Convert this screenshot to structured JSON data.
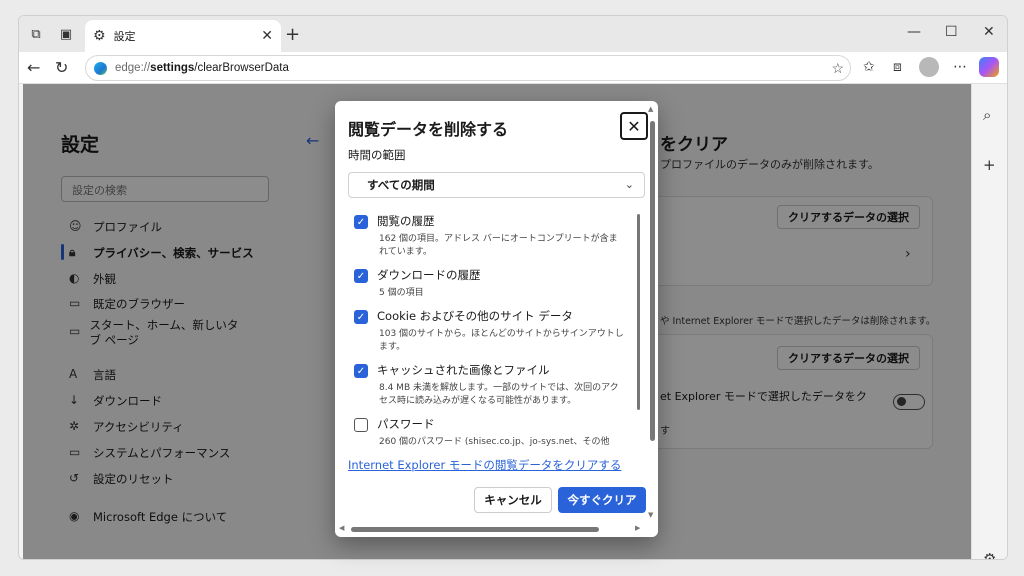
{
  "browser": {
    "tab_title": "設定",
    "url_proto": "edge://",
    "url_host": "settings",
    "url_path": "/clearBrowserData"
  },
  "settings": {
    "title": "設定",
    "search_placeholder": "設定の検索",
    "nav": [
      {
        "label": "プロファイル",
        "icon": "profile-icon"
      },
      {
        "label": "プライバシー、検索、サービス",
        "icon": "lock-icon",
        "active": true
      },
      {
        "label": "外観",
        "icon": "appearance-icon"
      },
      {
        "label": "既定のブラウザー",
        "icon": "browser-icon"
      },
      {
        "label": "スタート、ホーム、新しいタブ ページ",
        "icon": "home-icon"
      },
      {
        "label": "言語",
        "icon": "language-icon"
      },
      {
        "label": "ダウンロード",
        "icon": "download-icon"
      },
      {
        "label": "アクセシビリティ",
        "icon": "accessibility-icon"
      },
      {
        "label": "システムとパフォーマンス",
        "icon": "system-icon"
      },
      {
        "label": "設定のリセット",
        "icon": "reset-icon"
      },
      {
        "label": "Microsoft Edge について",
        "icon": "edge-icon"
      }
    ]
  },
  "main": {
    "title": "をクリア",
    "subtitle": "プロファイルのデータのみが削除されます。",
    "choose_button_1": "クリアするデータの選択",
    "ie_note": "や Internet Explorer モードで選択したデータは削除されます。",
    "choose_button_2": "クリアするデータの選択",
    "ie_text": "et Explorer モードで選択したデータをク",
    "ie_suffix": "す"
  },
  "dialog": {
    "title": "閲覧データを削除する",
    "time_range_label": "時間の範囲",
    "time_range_value": "すべての期間",
    "options": [
      {
        "label": "閲覧の履歴",
        "desc": "162 個の項目。アドレス バーにオートコンプリートが含まれています。",
        "checked": true
      },
      {
        "label": "ダウンロードの履歴",
        "desc": "5 個の項目",
        "checked": true
      },
      {
        "label": "Cookie およびその他のサイト データ",
        "desc": "103 個のサイトから。ほとんどのサイトからサインアウトします。",
        "checked": true
      },
      {
        "label": "キャッシュされた画像とファイル",
        "desc": "8.4 MB 未満を解放します。一部のサイトでは、次回のアクセス時に読み込みが遅くなる可能性があります。",
        "checked": true
      },
      {
        "label": "パスワード",
        "desc": "260 個のパスワード (shisec.co.jp、jo-sys.net、その他",
        "checked": false
      }
    ],
    "ie_link": "Internet Explorer モードの閲覧データをクリアする",
    "cancel": "キャンセル",
    "clear_now": "今すぐクリア"
  }
}
